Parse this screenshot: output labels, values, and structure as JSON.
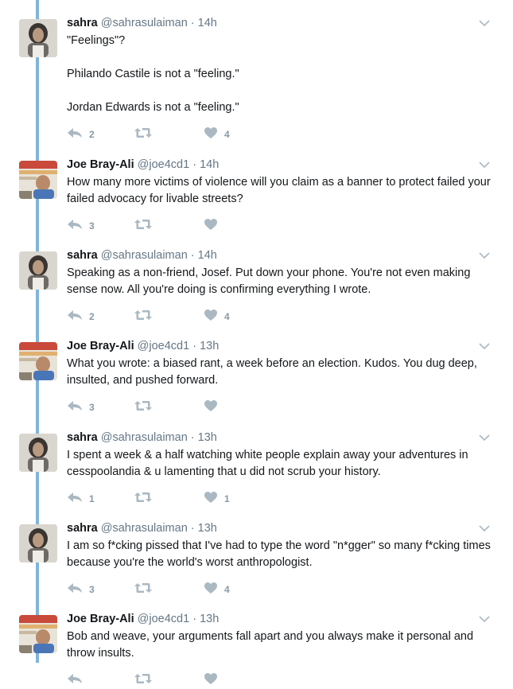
{
  "colors": {
    "thread_line": "#7fb5d9",
    "icon_gray": "#aab8c2",
    "meta_gray": "#657786"
  },
  "tweets": [
    {
      "author": "sahra",
      "name": "sahra",
      "handle": "@sahrasulaiman",
      "sep": "·",
      "time": "14h",
      "paragraphs": [
        "\"Feelings\"?",
        "Philando Castile is not a \"feeling.\"",
        "Jordan Edwards is not a \"feeling.\""
      ],
      "replies": "2",
      "retweets": "",
      "likes": "4"
    },
    {
      "author": "joe",
      "name": "Joe Bray-Ali",
      "handle": "@joe4cd1",
      "sep": "·",
      "time": "14h",
      "paragraphs": [
        "How many more victims of violence will you claim as a banner to protect failed your failed advocacy for livable streets?"
      ],
      "replies": "3",
      "retweets": "",
      "likes": ""
    },
    {
      "author": "sahra",
      "name": "sahra",
      "handle": "@sahrasulaiman",
      "sep": "·",
      "time": "14h",
      "paragraphs": [
        "Speaking as a non-friend, Josef. Put down your phone. You're not even making sense now. All you're doing is confirming everything I wrote."
      ],
      "replies": "2",
      "retweets": "",
      "likes": "4"
    },
    {
      "author": "joe",
      "name": "Joe Bray-Ali",
      "handle": "@joe4cd1",
      "sep": "·",
      "time": "13h",
      "paragraphs": [
        "What you wrote: a biased rant, a week before an election. Kudos. You dug deep, insulted, and pushed forward."
      ],
      "replies": "3",
      "retweets": "",
      "likes": ""
    },
    {
      "author": "sahra",
      "name": "sahra",
      "handle": "@sahrasulaiman",
      "sep": "·",
      "time": "13h",
      "paragraphs": [
        "I spent a week & a half watching white people explain away your adventures in cesspoolandia & u lamenting that u did not scrub your history."
      ],
      "replies": "1",
      "retweets": "",
      "likes": "1"
    },
    {
      "author": "sahra",
      "name": "sahra",
      "handle": "@sahrasulaiman",
      "sep": "·",
      "time": "13h",
      "paragraphs": [
        "I am so f*cking pissed that I've had to type the word \"n*gger\" so many f*cking times because you're the world's worst anthropologist."
      ],
      "replies": "3",
      "retweets": "",
      "likes": "4"
    },
    {
      "author": "joe",
      "name": "Joe Bray-Ali",
      "handle": "@joe4cd1",
      "sep": "·",
      "time": "13h",
      "paragraphs": [
        "Bob and weave, your arguments fall apart and you always make it personal and throw insults."
      ],
      "replies": "",
      "retweets": "",
      "likes": ""
    }
  ]
}
